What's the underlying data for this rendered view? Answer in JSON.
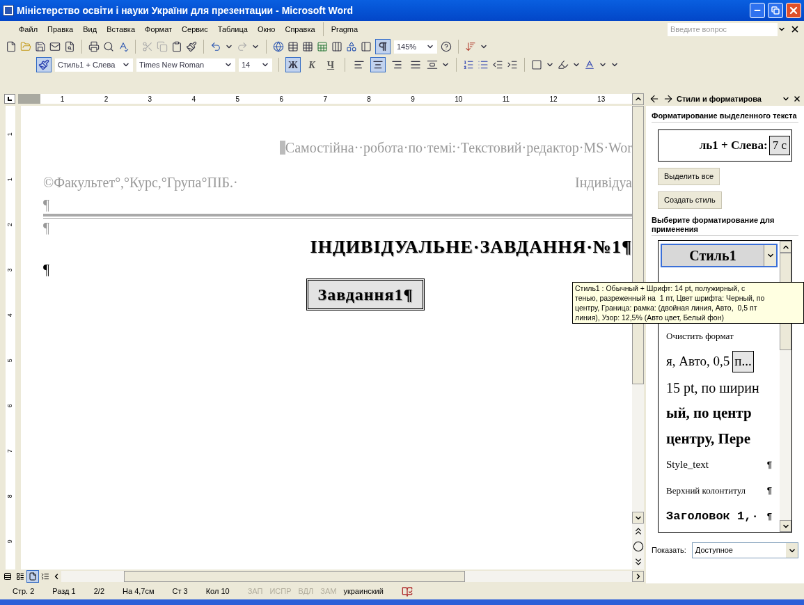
{
  "window": {
    "title": "Міністерство освіти і науки України для презентации - Microsoft Word"
  },
  "menu": [
    "Файл",
    "Правка",
    "Вид",
    "Вставка",
    "Формат",
    "Сервис",
    "Таблица",
    "Окно",
    "Справка",
    "Pragma"
  ],
  "help_search": {
    "placeholder": "Введите вопрос"
  },
  "standard_toolbar": {
    "show_marks": {
      "selected": true
    },
    "zoom": "145%"
  },
  "formatting_toolbar": {
    "style": "Стиль1 + Слева",
    "font": "Times New Roman",
    "size": "14",
    "format_buttons": [
      {
        "label": "Ж",
        "selected": true
      },
      {
        "label": "К",
        "selected": false
      },
      {
        "label": "Ч",
        "selected": false
      }
    ],
    "align_buttons": [
      {
        "selected": false
      },
      {
        "selected": true
      },
      {
        "selected": false
      },
      {
        "selected": false
      }
    ]
  },
  "ruler": {
    "numbers": [
      "1",
      "2",
      "3",
      "4",
      "5",
      "6",
      "7",
      "8",
      "9",
      "10",
      "11",
      "12",
      "13"
    ]
  },
  "vertical_ruler": {
    "numbers": [
      "1",
      "1",
      "2",
      "3",
      "4",
      "5",
      "6",
      "7",
      "8",
      "9"
    ]
  },
  "document": {
    "header_title": "Самостійна··робота·по·темі:·Текстовий·редактор·MS·Wor",
    "header_left": "©Факультет°,°Курс,°Група°ПІБ.·",
    "header_right": "Індивідуа",
    "header_mark": "¶",
    "mark_after_rule": "¶",
    "heading": "ІНДИВІДУАЛЬНЕ·ЗАВДАННЯ·№1¶",
    "empty_mark": "¶",
    "boxed_text": "Завдання1¶"
  },
  "view_buttons": [
    {
      "selected": false
    },
    {
      "selected": false
    },
    {
      "selected": true
    },
    {
      "selected": false
    }
  ],
  "status_bar": [
    {
      "text": "Стр. 2",
      "disabled": false
    },
    {
      "text": "Разд 1",
      "disabled": false
    },
    {
      "text": "2/2",
      "disabled": false
    },
    {
      "text": "На 4,7см",
      "disabled": false
    },
    {
      "text": "Ст 3",
      "disabled": false
    },
    {
      "text": "Кол 10",
      "disabled": false
    },
    {
      "text": "ЗАП",
      "disabled": true
    },
    {
      "text": "ИСПР",
      "disabled": true
    },
    {
      "text": "ВДЛ",
      "disabled": true
    },
    {
      "text": "ЗАМ",
      "disabled": true
    },
    {
      "text": "украинский",
      "disabled": false
    }
  ],
  "task_pane": {
    "title": "Стили и форматирова",
    "selected_heading": "Форматирование выделенного текста",
    "current_format": "ль1 + Слева:",
    "current_format_box": "7 с",
    "buttons": [
      "Выделить все",
      "Создать стиль"
    ],
    "apply_heading": "Выберите форматирование для применения",
    "styles": [
      {
        "kind": "selected_style",
        "text": "Стиль1",
        "selected": true
      },
      {
        "kind": "small",
        "text": "Очистить формат",
        "selected": false
      },
      {
        "kind": "boxed",
        "text": "я, Авто,  0,5",
        "box": "п...",
        "selected": false
      },
      {
        "kind": "large",
        "text": "15 pt, по ширин",
        "selected": false
      },
      {
        "kind": "bold",
        "text": "ый, по центр",
        "selected": false
      },
      {
        "kind": "bold",
        "text": "центру, Пере",
        "selected": false
      },
      {
        "kind": "normal",
        "text": "Style_text",
        "mark": "¶",
        "selected": false
      },
      {
        "kind": "small",
        "text": "Верхний колонтитул",
        "mark": "¶",
        "selected": false
      },
      {
        "kind": "mono",
        "text": "Заголовок 1,·",
        "mark": "¶",
        "selected": false
      }
    ],
    "show_label": "Показать:",
    "show_value": "Доступное"
  },
  "tooltip": {
    "lines": [
      "Стиль1 : Обычный + Шрифт: 14 pt, полужирный, с",
      "тенью, разреженный на  1 пт, Цвет шрифта: Черный, по",
      "центру, Граница: рамка: (двойная линия, Авто,  0,5 пт",
      "линия), Узор: 12,5% (Авто цвет, Белый фон)"
    ]
  }
}
